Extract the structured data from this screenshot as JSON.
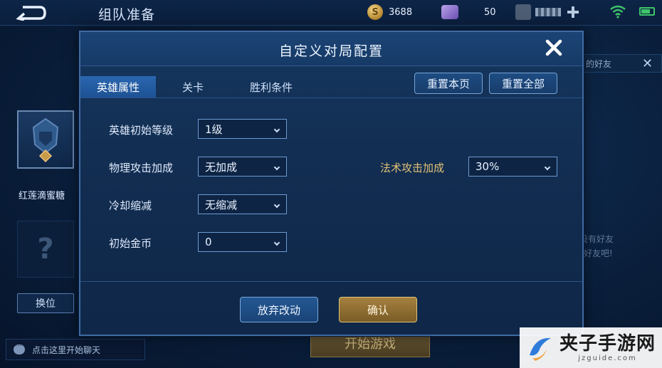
{
  "topbar": {
    "title": "组队准备",
    "gold_amount": "3688",
    "gem_amount": "50",
    "icons": [
      "back-icon",
      "coin-icon",
      "gem-icon",
      "add-icon",
      "wifi-icon",
      "battery-icon"
    ]
  },
  "lobby": {
    "player_name": "红莲滴蜜糖",
    "empty_slot_mark": "?",
    "swap_label": "换位",
    "ghost_swap_label": "换位",
    "chat_placeholder": "点击这里开始聊天",
    "start_game_label": "开始游戏",
    "friend_hint_text": "的好友",
    "friend_empty_line1": "没有好友",
    "friend_empty_line2": "好友吧!"
  },
  "modal": {
    "title": "自定义对局配置",
    "tabs": [
      {
        "label": "英雄属性",
        "active": true
      },
      {
        "label": "关卡",
        "active": false
      },
      {
        "label": "胜利条件",
        "active": false
      }
    ],
    "reset_page_label": "重置本页",
    "reset_all_label": "重置全部",
    "fields": {
      "hero_level": {
        "label": "英雄初始等级",
        "value": "1级"
      },
      "physical_bonus": {
        "label": "物理攻击加成",
        "value": "无加成"
      },
      "magic_bonus": {
        "label": "法术攻击加成",
        "value": "30%"
      },
      "cooldown": {
        "label": "冷却缩减",
        "value": "无缩减"
      },
      "initial_gold": {
        "label": "初始金币",
        "value": "0"
      }
    },
    "discard_label": "放弃改动",
    "confirm_label": "确认"
  },
  "watermark": {
    "title": "夹子手游网",
    "url": "jzguide.com"
  },
  "colors": {
    "accent_blue": "#2a67b0",
    "gold_label": "#e0c075",
    "confirm_gold": "#a5813f",
    "battery_green": "#3ec46a"
  }
}
